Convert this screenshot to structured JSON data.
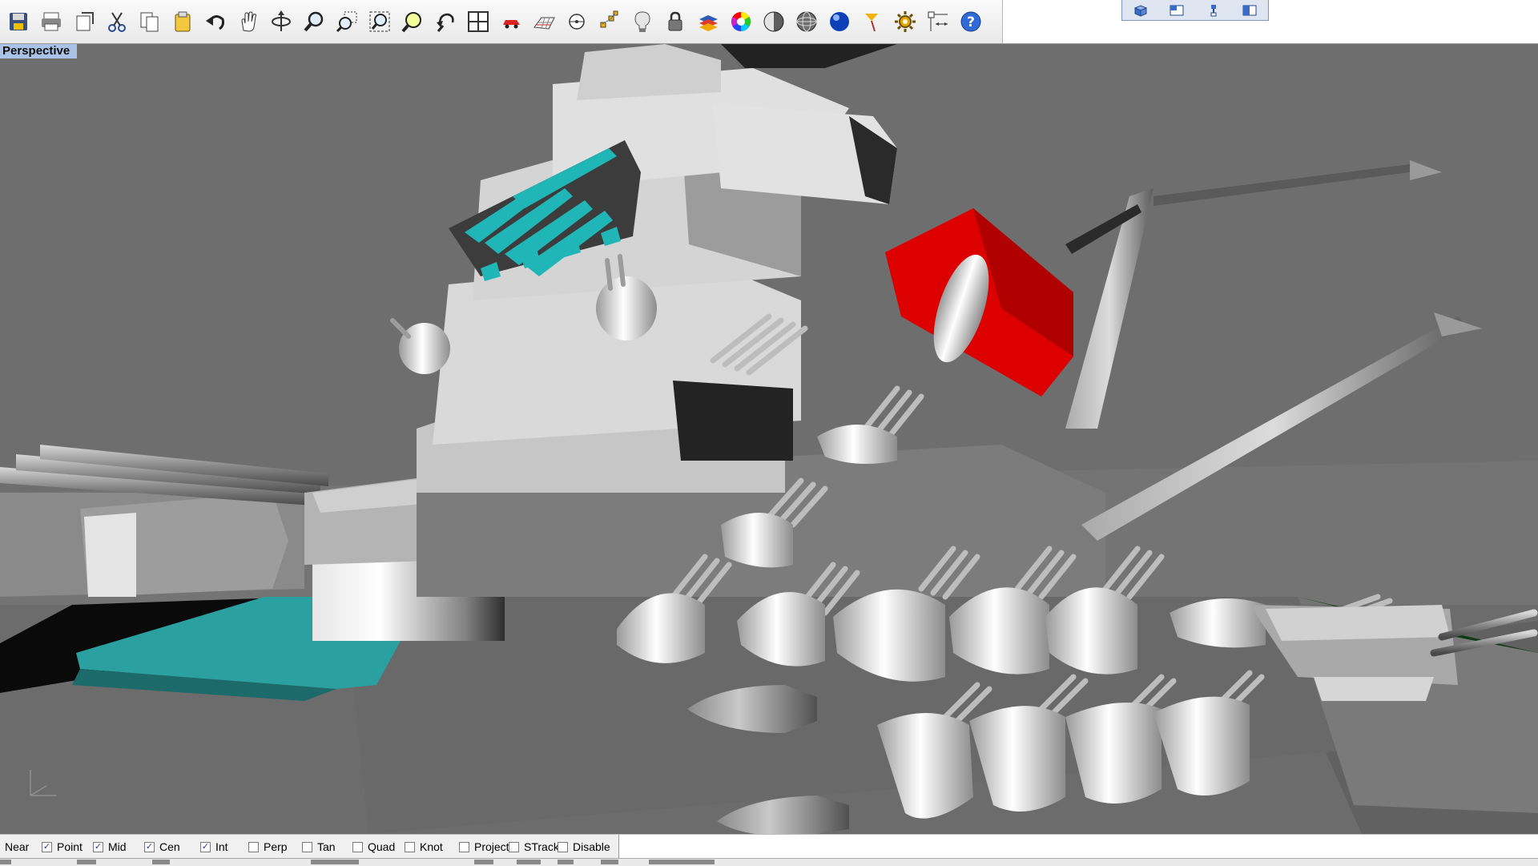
{
  "viewport": {
    "title": "Perspective"
  },
  "toolbar": {
    "buttons": [
      {
        "name": "save-icon"
      },
      {
        "name": "print-icon"
      },
      {
        "name": "export-icon"
      },
      {
        "name": "cut-icon"
      },
      {
        "name": "copy-icon"
      },
      {
        "name": "paste-icon"
      },
      {
        "name": "undo-icon"
      },
      {
        "name": "pan-hand-icon"
      },
      {
        "name": "rotate-view-icon"
      },
      {
        "name": "zoom-icon"
      },
      {
        "name": "zoom-window-icon"
      },
      {
        "name": "zoom-extents-icon"
      },
      {
        "name": "zoom-selected-icon"
      },
      {
        "name": "undo-view-icon"
      },
      {
        "name": "four-viewports-icon"
      },
      {
        "name": "car-icon"
      },
      {
        "name": "grid-plane-icon"
      },
      {
        "name": "point-filter-icon"
      },
      {
        "name": "select-points-icon"
      },
      {
        "name": "light-bulb-icon"
      },
      {
        "name": "lock-icon"
      },
      {
        "name": "layers-icon"
      },
      {
        "name": "color-wheel-icon"
      },
      {
        "name": "shade-sphere-icon"
      },
      {
        "name": "wireframe-sphere-icon"
      },
      {
        "name": "render-sphere-icon"
      },
      {
        "name": "pointer-flag-icon"
      },
      {
        "name": "options-gear-icon"
      },
      {
        "name": "dimension-icon"
      },
      {
        "name": "help-icon"
      }
    ],
    "viewport_buttons": [
      {
        "name": "viewport-3d-icon"
      },
      {
        "name": "viewport-layout-icon"
      },
      {
        "name": "viewport-split-icon"
      },
      {
        "name": "viewport-tile-icon"
      }
    ]
  },
  "osnap": {
    "items": [
      {
        "label": "Near",
        "checked": false
      },
      {
        "label": "Point",
        "checked": true
      },
      {
        "label": "Mid",
        "checked": true
      },
      {
        "label": "Cen",
        "checked": true
      },
      {
        "label": "Int",
        "checked": true
      },
      {
        "label": "Perp",
        "checked": false
      },
      {
        "label": "Tan",
        "checked": false
      },
      {
        "label": "Quad",
        "checked": false
      },
      {
        "label": "Knot",
        "checked": false
      },
      {
        "label": "Project",
        "checked": false
      },
      {
        "label": "STrack",
        "checked": false
      },
      {
        "label": "Disable",
        "checked": false
      }
    ],
    "check_glyph": "✓"
  },
  "colors": {
    "viewport_bg": "#6e6e6e",
    "title_bg": "#a9c3e6",
    "hull_red": "#dd0000",
    "window_cyan": "#20b6b8",
    "deck_teal": "#2aa0a0"
  }
}
